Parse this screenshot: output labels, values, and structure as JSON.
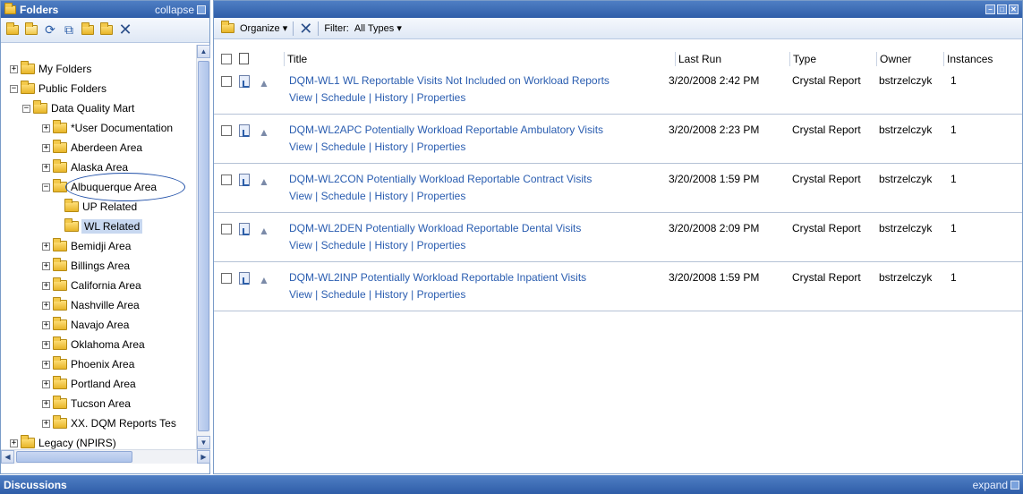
{
  "left_panel": {
    "title": "Folders",
    "collapse_label": "collapse",
    "toolbar_icons": [
      "new-folder-icon",
      "open-folder-icon",
      "refresh-icon",
      "copy-icon",
      "move-folder-icon",
      "export-folder-icon",
      "delete-icon"
    ]
  },
  "tree": [
    {
      "label": "My Folders",
      "toggle": "+",
      "expanded": false,
      "level": 0
    },
    {
      "label": "Public Folders",
      "toggle": "−",
      "expanded": true,
      "level": 0
    },
    {
      "label": "Data Quality Mart",
      "toggle": "−",
      "expanded": true,
      "level": 1
    },
    {
      "label": "*User Documentation",
      "toggle": "+",
      "expanded": false,
      "level": 2
    },
    {
      "label": "Aberdeen Area",
      "toggle": "+",
      "expanded": false,
      "level": 2
    },
    {
      "label": "Alaska Area",
      "toggle": "+",
      "expanded": false,
      "level": 2
    },
    {
      "label": "Albuquerque Area",
      "toggle": "−",
      "expanded": true,
      "level": 2
    },
    {
      "label": "UP Related",
      "toggle": "",
      "expanded": false,
      "level": 3
    },
    {
      "label": "WL Related",
      "toggle": "",
      "expanded": false,
      "level": 3,
      "selected": true
    },
    {
      "label": "Bemidji Area",
      "toggle": "+",
      "expanded": false,
      "level": 2
    },
    {
      "label": "Billings Area",
      "toggle": "+",
      "expanded": false,
      "level": 2
    },
    {
      "label": "California Area",
      "toggle": "+",
      "expanded": false,
      "level": 2
    },
    {
      "label": "Nashville Area",
      "toggle": "+",
      "expanded": false,
      "level": 2
    },
    {
      "label": "Navajo Area",
      "toggle": "+",
      "expanded": false,
      "level": 2
    },
    {
      "label": "Oklahoma Area",
      "toggle": "+",
      "expanded": false,
      "level": 2
    },
    {
      "label": "Phoenix Area",
      "toggle": "+",
      "expanded": false,
      "level": 2
    },
    {
      "label": "Portland Area",
      "toggle": "+",
      "expanded": false,
      "level": 2
    },
    {
      "label": "Tucson Area",
      "toggle": "+",
      "expanded": false,
      "level": 2
    },
    {
      "label": "XX. DQM Reports Tes",
      "toggle": "+",
      "expanded": false,
      "level": 2
    },
    {
      "label": "Legacy (NPIRS)",
      "toggle": "+",
      "expanded": false,
      "level": 0
    }
  ],
  "right_panel": {
    "toolbar": {
      "organize_label": "Organize",
      "filter_label": "Filter:",
      "filter_value": "All Types"
    },
    "columns": {
      "title": "Title",
      "last_run": "Last Run",
      "type": "Type",
      "owner": "Owner",
      "instances": "Instances"
    },
    "actions": {
      "view": "View",
      "schedule": "Schedule",
      "history": "History",
      "properties": "Properties",
      "sep": "|"
    },
    "rows": [
      {
        "title": "DQM-WL1 WL Reportable Visits Not Included on Workload Reports",
        "last_run": "3/20/2008 2:42 PM",
        "type": "Crystal Report",
        "owner": "bstrzelczyk",
        "instances": "1"
      },
      {
        "title": "DQM-WL2APC Potentially Workload Reportable Ambulatory Visits",
        "last_run": "3/20/2008 2:23 PM",
        "type": "Crystal Report",
        "owner": "bstrzelczyk",
        "instances": "1"
      },
      {
        "title": "DQM-WL2CON Potentially Workload Reportable Contract Visits",
        "last_run": "3/20/2008 1:59 PM",
        "type": "Crystal Report",
        "owner": "bstrzelczyk",
        "instances": "1"
      },
      {
        "title": "DQM-WL2DEN Potentially Workload Reportable Dental Visits",
        "last_run": "3/20/2008 2:09 PM",
        "type": "Crystal Report",
        "owner": "bstrzelczyk",
        "instances": "1"
      },
      {
        "title": "DQM-WL2INP Potentially Workload Reportable Inpatient Visits",
        "last_run": "3/20/2008 1:59 PM",
        "type": "Crystal Report",
        "owner": "bstrzelczyk",
        "instances": "1"
      }
    ]
  },
  "bottom_bar": {
    "title": "Discussions",
    "expand_label": "expand"
  }
}
